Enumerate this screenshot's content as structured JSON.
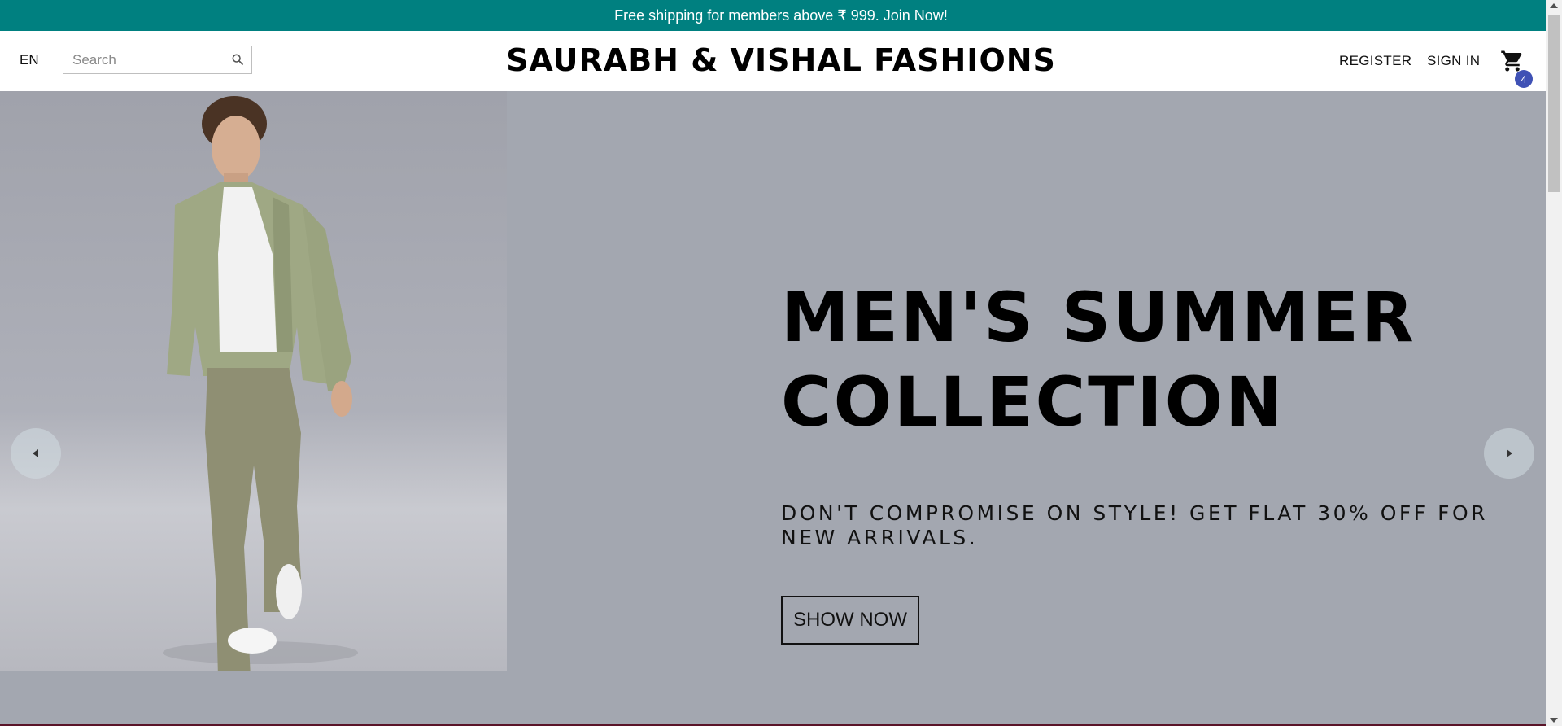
{
  "announcement": {
    "text": "Free shipping for members above ₹ 999. Join Now!"
  },
  "header": {
    "language": "EN",
    "search": {
      "placeholder": "Search",
      "value": ""
    },
    "brand": "SAURABH & VISHAL FASHIONS",
    "register_label": "REGISTER",
    "signin_label": "SIGN IN",
    "cart_count": "4"
  },
  "hero": {
    "title_line1": "MEN'S SUMMER",
    "title_line2": "COLLECTION",
    "description": "DON'T COMPROMISE ON STYLE! GET FLAT 30% OFF FOR NEW ARRIVALS.",
    "button_label": "SHOW NOW",
    "image": "man-in-green-jacket-photo"
  },
  "icons": {
    "search": "search-icon",
    "cart": "cart-icon",
    "prev": "arrow-left-icon",
    "next": "arrow-right-icon"
  },
  "colors": {
    "announcement_bg": "#008080",
    "hero_bg": "#a3a7b0",
    "badge_bg": "#3f51b5"
  }
}
